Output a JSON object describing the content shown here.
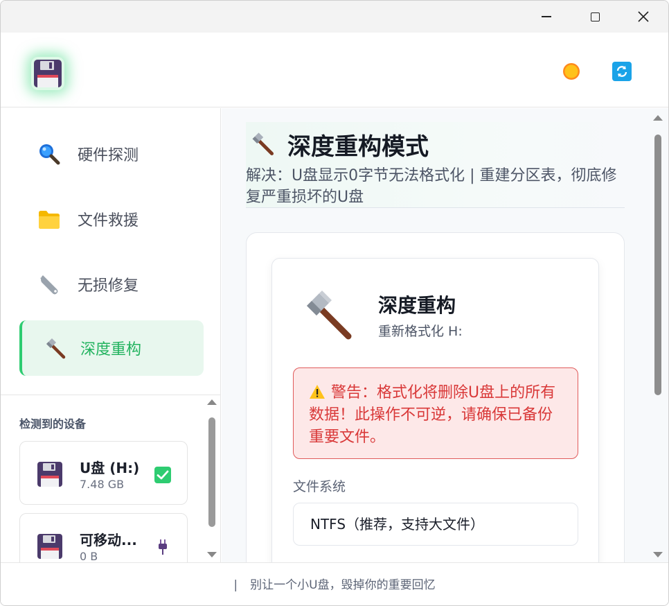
{
  "window": {
    "minimize_label": "Minimize",
    "maximize_label": "Maximize",
    "close_label": "Close"
  },
  "header": {
    "logo_icon": "floppy-disk-icon",
    "theme_icon": "sun-icon",
    "refresh_icon": "refresh-icon"
  },
  "sidebar": {
    "items": [
      {
        "label": "硬件探测",
        "icon": "magnifier-icon",
        "active": false
      },
      {
        "label": "文件救援",
        "icon": "folder-icon",
        "active": false
      },
      {
        "label": "无损修复",
        "icon": "wrench-icon",
        "active": false
      },
      {
        "label": "深度重构",
        "icon": "hammer-icon",
        "active": true
      }
    ],
    "devices_title": "检测到的设备",
    "devices": [
      {
        "name": "U盘 (H:)",
        "size": "7.48 GB",
        "icon": "floppy-disk-icon",
        "status_icon": "check-icon"
      },
      {
        "name": "可移动...",
        "size": "0 B",
        "icon": "floppy-disk-icon",
        "status_icon": "plug-icon"
      }
    ]
  },
  "main": {
    "title": "深度重构模式",
    "description": "解决：U盘显示0字节无法格式化 | 重建分区表，彻底修复严重损坏的U盘",
    "card": {
      "title": "深度重构",
      "subtitle": "重新格式化 H:",
      "warning": "警告：格式化将删除U盘上的所有数据！此操作不可逆，请确保已备份重要文件。",
      "fs_label": "文件系统",
      "fs_value": "NTFS（推荐，支持大文件）"
    }
  },
  "footer": {
    "separator": "|",
    "text": "别让一个小U盘，毁掉你的重要回忆"
  },
  "colors": {
    "accent": "#22b35f",
    "warning": "#d93838",
    "refresh_bg": "#1aa3e8"
  }
}
